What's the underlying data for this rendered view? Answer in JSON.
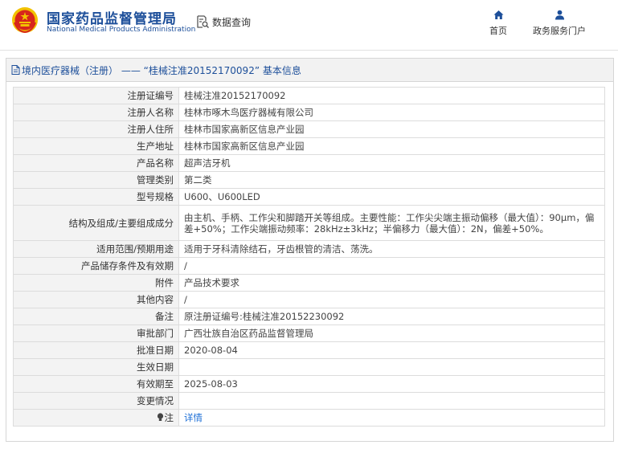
{
  "header": {
    "org_name_cn": "国家药品监督管理局",
    "org_name_en": "National Medical Products Administration",
    "query_label": "数据查询",
    "nav": [
      {
        "label": "首页",
        "icon": "home-icon"
      },
      {
        "label": "政务服务门户",
        "icon": "user-icon"
      }
    ]
  },
  "panel": {
    "title": "境内医疗器械（注册） —— “桂械注准20152170092” 基本信息"
  },
  "rows": [
    {
      "key": "注册证编号",
      "value": "桂械注准20152170092"
    },
    {
      "key": "注册人名称",
      "value": "桂林市啄木鸟医疗器械有限公司"
    },
    {
      "key": "注册人住所",
      "value": "桂林市国家高新区信息产业园"
    },
    {
      "key": "生产地址",
      "value": "桂林市国家高新区信息产业园"
    },
    {
      "key": "产品名称",
      "value": "超声洁牙机"
    },
    {
      "key": "管理类别",
      "value": "第二类"
    },
    {
      "key": "型号规格",
      "value": "U600、U600LED"
    },
    {
      "key": "结构及组成/主要组成成分",
      "value": "由主机、手柄、工作尖和脚踏开关等组成。主要性能：工作尖尖端主振动偏移（最大值）：90μm，偏差+50%；工作尖端振动频率：28kHz±3kHz；半偏移力（最大值）：2N，偏差+50%。"
    },
    {
      "key": "适用范围/预期用途",
      "value": "适用于牙科清除结石，牙齿根管的清洁、荡洗。"
    },
    {
      "key": "产品储存条件及有效期",
      "value": "/"
    },
    {
      "key": "附件",
      "value": "产品技术要求"
    },
    {
      "key": "其他内容",
      "value": "/"
    },
    {
      "key": "备注",
      "value": "原注册证编号:桂械注准20152230092"
    },
    {
      "key": "审批部门",
      "value": "广西壮族自治区药品监督管理局"
    },
    {
      "key": "批准日期",
      "value": "2020-08-04"
    },
    {
      "key": "生效日期",
      "value": ""
    },
    {
      "key": "有效期至",
      "value": "2025-08-03"
    },
    {
      "key": "变更情况",
      "value": ""
    },
    {
      "key": "注",
      "value": "详情",
      "icon": "bulb-icon"
    }
  ],
  "colors": {
    "brand_blue": "#1d4f9a",
    "link_blue": "#1d6fd6",
    "emblem_red": "#d7261c",
    "emblem_gold": "#f2c200"
  }
}
